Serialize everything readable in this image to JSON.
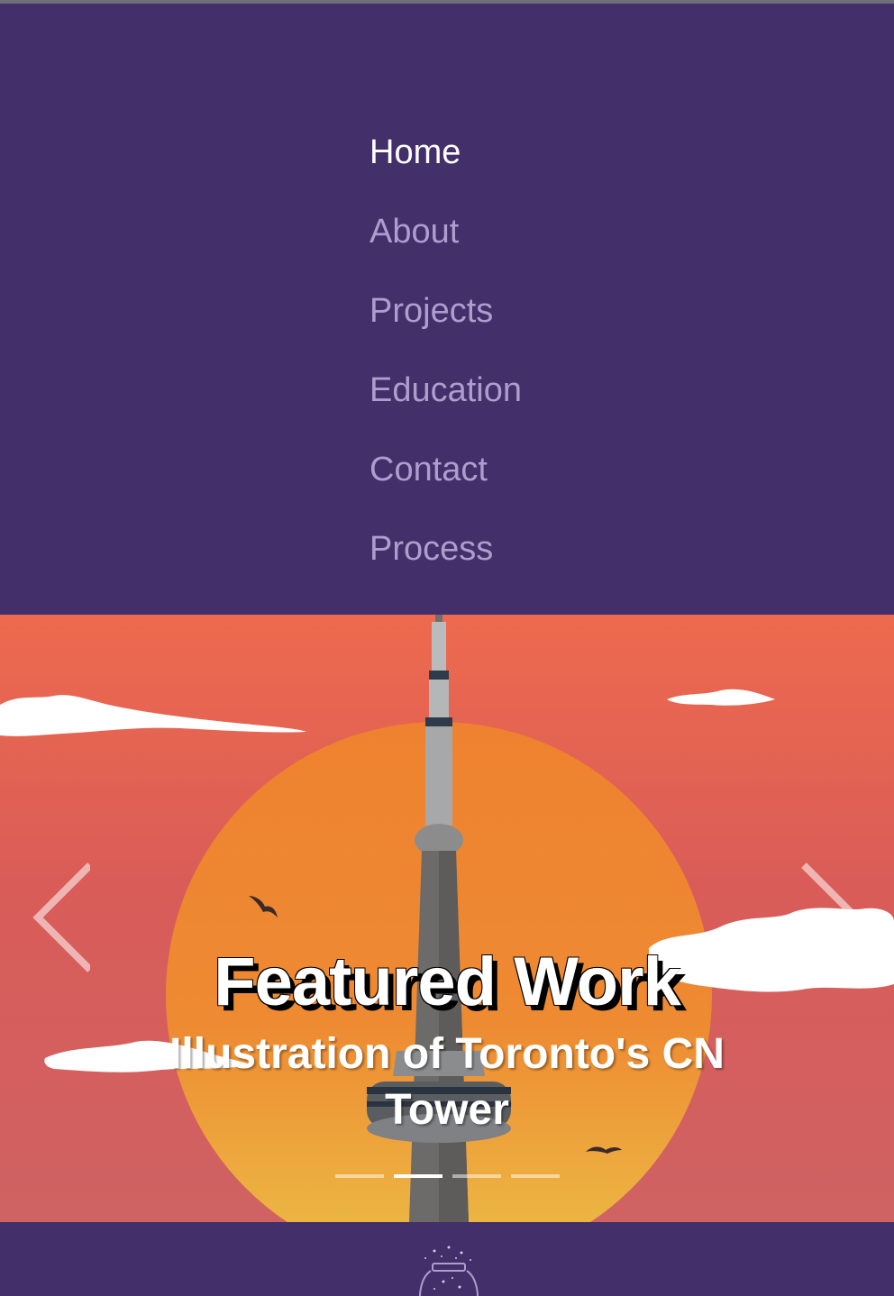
{
  "nav": {
    "items": [
      {
        "label": "Home",
        "active": true
      },
      {
        "label": "About",
        "active": false
      },
      {
        "label": "Projects",
        "active": false
      },
      {
        "label": "Education",
        "active": false
      },
      {
        "label": "Contact",
        "active": false
      },
      {
        "label": "Process",
        "active": false
      }
    ]
  },
  "carousel": {
    "caption_title": "Featured Work",
    "caption_text": "Illustration of Toronto's CN Tower",
    "slide_count": 4,
    "active_slide": 2,
    "prev_icon": "chevron-left-icon",
    "next_icon": "chevron-right-icon"
  },
  "footer": {
    "logo_icon": "star-jar-icon"
  },
  "colors": {
    "nav_bg": "#432f69",
    "nav_active": "#ffffff",
    "nav_inactive": "#b09ccd",
    "sky_top": "#ee6a4e",
    "sky_bottom": "#cf6263",
    "sun_top": "#ef8230",
    "sun_bottom": "#ecbf46"
  }
}
